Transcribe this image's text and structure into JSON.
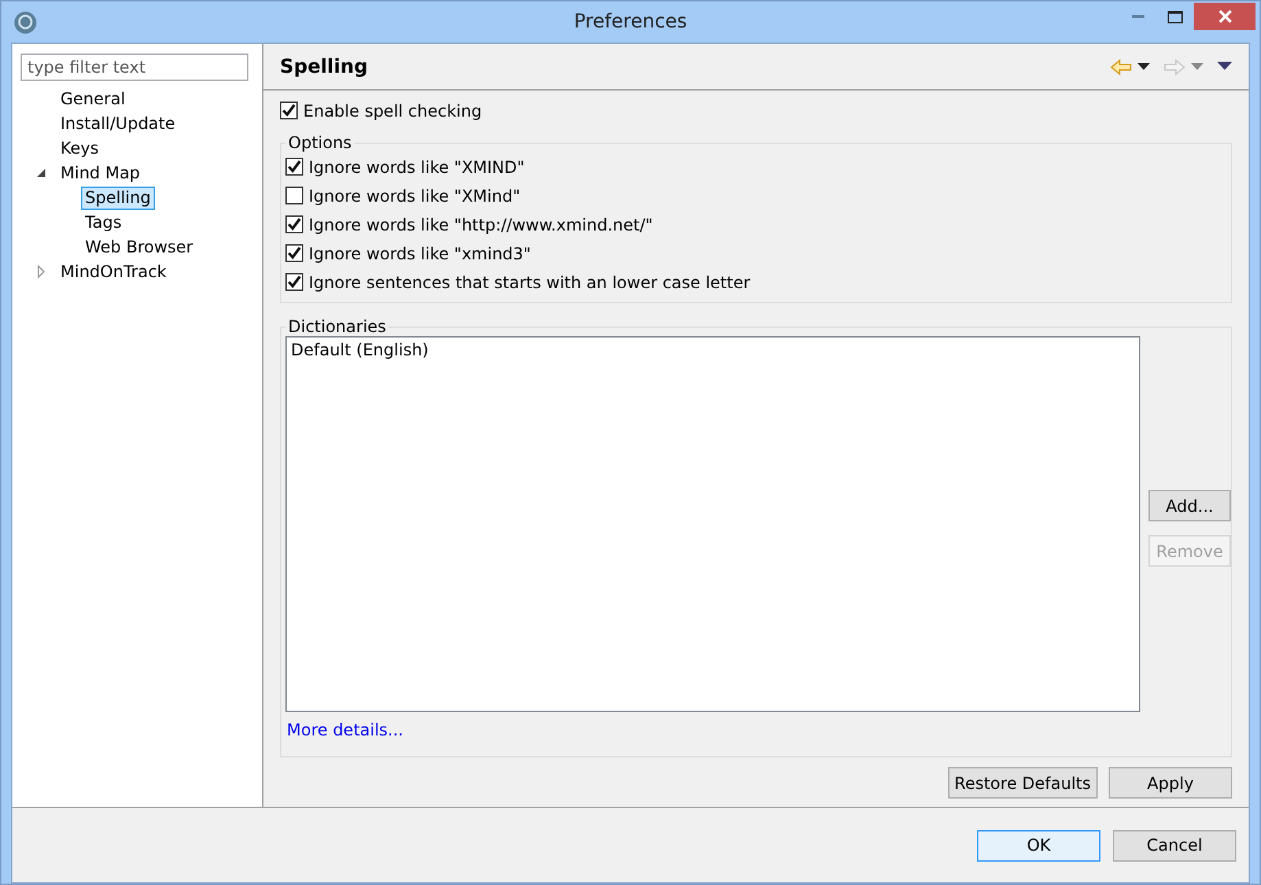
{
  "window": {
    "title": "Preferences"
  },
  "filter": {
    "placeholder": "type filter text"
  },
  "tree": [
    {
      "label": "General",
      "selected": false
    },
    {
      "label": "Install/Update",
      "selected": false
    },
    {
      "label": "Keys",
      "selected": false
    },
    {
      "label": "Mind Map",
      "selected": false,
      "expanded": true,
      "children": [
        {
          "label": "Spelling",
          "selected": true
        },
        {
          "label": "Tags",
          "selected": false
        },
        {
          "label": "Web Browser",
          "selected": false
        }
      ]
    },
    {
      "label": "MindOnTrack",
      "selected": false,
      "expanded": false
    }
  ],
  "page": {
    "title": "Spelling"
  },
  "enable": {
    "label": "Enable spell checking",
    "checked": true
  },
  "options": {
    "title": "Options",
    "items": [
      {
        "label": "Ignore words like \"XMIND\"",
        "checked": true
      },
      {
        "label": "Ignore words like \"XMind\"",
        "checked": false
      },
      {
        "label": "Ignore words like \"http://www.xmind.net/\"",
        "checked": true
      },
      {
        "label": "Ignore words like \"xmind3\"",
        "checked": true
      },
      {
        "label": "Ignore sentences that starts with an lower case letter",
        "checked": true
      }
    ]
  },
  "dictionaries": {
    "title": "Dictionaries",
    "items": [
      "Default (English)"
    ],
    "buttons": [
      {
        "label": "Add...",
        "disabled": false
      },
      {
        "label": "Remove",
        "disabled": true
      }
    ],
    "link": "More details..."
  },
  "page_buttons": [
    "Restore Defaults",
    "Apply"
  ],
  "dialog_buttons": [
    {
      "label": "OK",
      "default": true
    },
    {
      "label": "Cancel",
      "default": false
    }
  ]
}
